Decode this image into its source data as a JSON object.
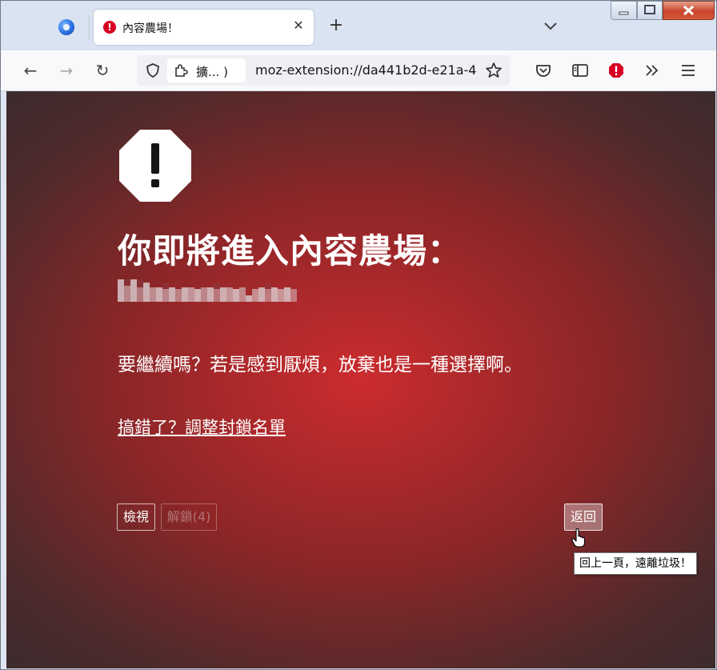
{
  "browser": {
    "tab": {
      "title": "內容農場！",
      "close_glyph": "✕"
    },
    "new_tab_glyph": "+",
    "nav": {
      "back_glyph": "←",
      "forward_glyph": "→",
      "reload_glyph": "↻"
    },
    "url": {
      "extension_label": "擴... )",
      "address": "moz-extension://da441b2d-e21a-4"
    },
    "toolbar_icons": [
      "pocket-icon",
      "reader-view-icon",
      "extension-warning-icon",
      "overflow-icon",
      "menu-icon"
    ]
  },
  "page": {
    "headline": "你即將進入內容農場：",
    "question": "要繼續嗎？若是感到厭煩，放棄也是一種選擇啊。",
    "adjust_link": "搞錯了？調整封鎖名單",
    "buttons": {
      "view": "檢視",
      "unlock": "解鎖(4)",
      "back": "返回"
    },
    "tooltip": "回上一頁，遠離垃圾！"
  },
  "colors": {
    "accent_red": "#d70022",
    "page_bg_center": "#cc2c2e",
    "page_bg_edge": "#3a2b2c"
  }
}
